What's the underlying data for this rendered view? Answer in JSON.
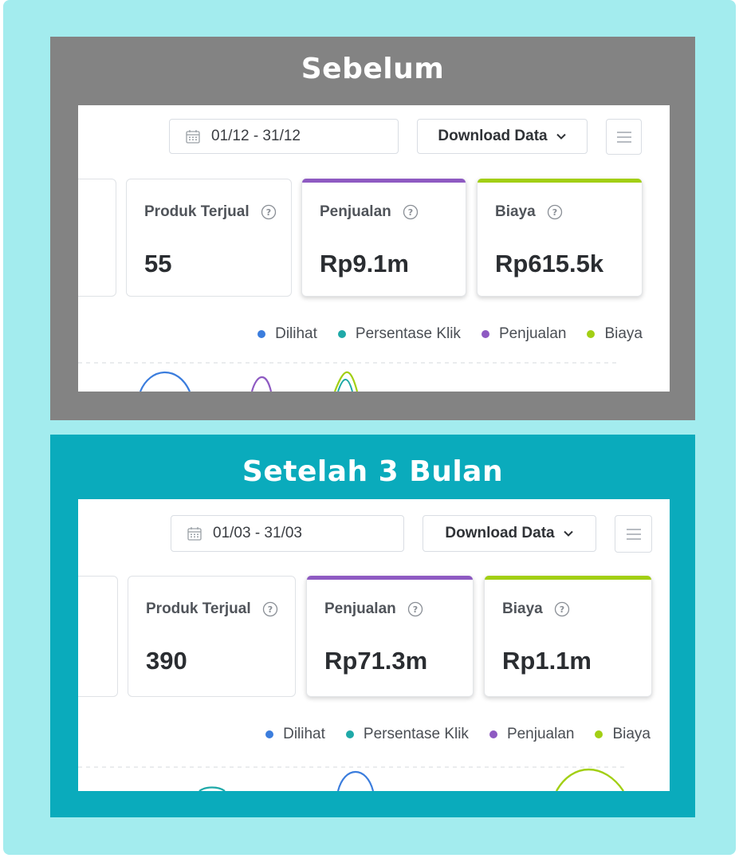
{
  "panels": [
    {
      "title": "Sebelum",
      "date_range": "01/12 - 31/12",
      "download_label": "Download Data",
      "cards": [
        {
          "label": "Produk Terjual",
          "value": "55"
        },
        {
          "label": "Penjualan",
          "value": "Rp9.1m"
        },
        {
          "label": "Biaya",
          "value": "Rp615.5k"
        }
      ]
    },
    {
      "title": "Setelah 3 Bulan",
      "date_range": "01/03 - 31/03",
      "download_label": "Download Data",
      "cards": [
        {
          "label": "Produk Terjual",
          "value": "390"
        },
        {
          "label": "Penjualan",
          "value": "Rp71.3m"
        },
        {
          "label": "Biaya",
          "value": "Rp1.1m"
        }
      ]
    }
  ],
  "legend": [
    {
      "label": "Dilihat",
      "color": "#3b7ddd"
    },
    {
      "label": "Persentase Klik",
      "color": "#1fa9a8"
    },
    {
      "label": "Penjualan",
      "color": "#8e5ac2"
    },
    {
      "label": "Biaya",
      "color": "#a2cf14"
    }
  ],
  "colors": {
    "penjualan_accent": "#8e5ac2",
    "biaya_accent": "#a2cf14",
    "panel_before_bg": "#838383",
    "panel_after_bg": "#0aabbc",
    "page_bg": "#a3ecee"
  },
  "icons": {
    "date": "calendar-icon",
    "download": "chevron-down-icon",
    "menu": "hamburger-menu-icon",
    "help": "help-circle-icon"
  }
}
